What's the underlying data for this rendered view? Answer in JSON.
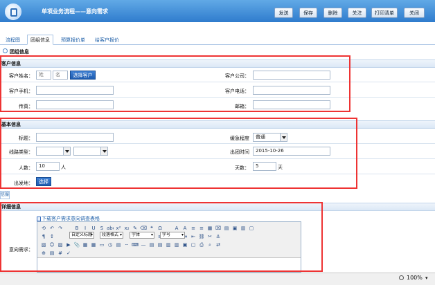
{
  "header": {
    "title": "单项业务流程——意向需求",
    "buttons": [
      "发送",
      "保存",
      "删除",
      "关注",
      "打印清单",
      "关闭"
    ]
  },
  "tabs": [
    {
      "label": "流程图",
      "selected": false
    },
    {
      "label": "团组信息",
      "selected": true
    },
    {
      "label": "预算报价单",
      "selected": false
    },
    {
      "label": "给客户报价",
      "selected": false
    }
  ],
  "section_heading": "团组信息",
  "customer": {
    "section_title": "客户信息",
    "name_label": "客户姓名：",
    "surname_placeholder": "姓",
    "given_placeholder": "名",
    "select_button": "选择客户",
    "mobile_label": "客户手机：",
    "fax_label": "传真：",
    "company_label": "客户公司：",
    "phone_label": "客户电话：",
    "email_label": "邮箱："
  },
  "basic": {
    "section_title": "基本信息",
    "title_label": "标题：",
    "urgency_label": "缓急程度",
    "urgency_value": "普通",
    "route_label": "线路类型：",
    "depart_time_label": "出团时间",
    "depart_time_value": "2015-10-26",
    "people_label": "人数：",
    "people_value": "10",
    "people_unit": "人",
    "days_label": "天数：",
    "days_value": "5",
    "days_unit": "天",
    "origin_label": "出发地：",
    "origin_button": "选择"
  },
  "side_tab": "信服",
  "detail": {
    "section_title": "详细信息",
    "download_link": "下载客户需求意向调查表格",
    "intent_label": "意向需求：",
    "toolbar_dropdowns": [
      "自定义标题",
      "段落格式",
      "字体",
      "字号"
    ]
  },
  "statusbar": {
    "zoom": "100%"
  },
  "colors": {
    "header_blue": "#2f7ccd",
    "button_blue": "#1e5cb0",
    "highlight_red": "#e33333"
  }
}
